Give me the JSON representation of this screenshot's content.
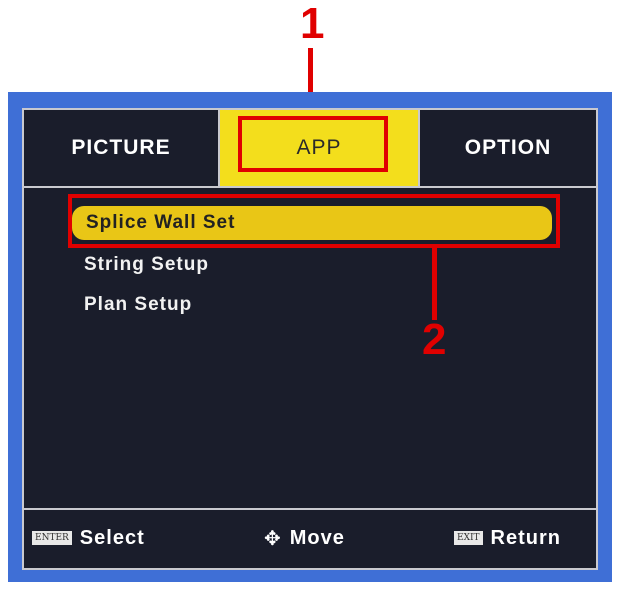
{
  "callouts": {
    "one": "1",
    "two": "2"
  },
  "tabs": [
    {
      "label": "PICTURE",
      "selected": false
    },
    {
      "label": "APP",
      "selected": true
    },
    {
      "label": "OPTION",
      "selected": false
    }
  ],
  "menu": {
    "items": [
      {
        "label": "Splice Wall Set",
        "selected": true
      },
      {
        "label": "String Setup",
        "selected": false
      },
      {
        "label": "Plan Setup",
        "selected": false
      }
    ]
  },
  "footer": {
    "select": {
      "key": "ENTER",
      "label": "Select"
    },
    "move": {
      "icon": "dpad-arrows-icon",
      "glyph": "✥",
      "label": "Move"
    },
    "return": {
      "key": "EXIT",
      "label": "Return"
    }
  },
  "colors": {
    "frame_blue": "#3f6fd6",
    "osd_background": "#1a1d2b",
    "tab_highlight": "#f3de1c",
    "item_highlight": "#e9c616",
    "annotation_red": "#e00000"
  }
}
